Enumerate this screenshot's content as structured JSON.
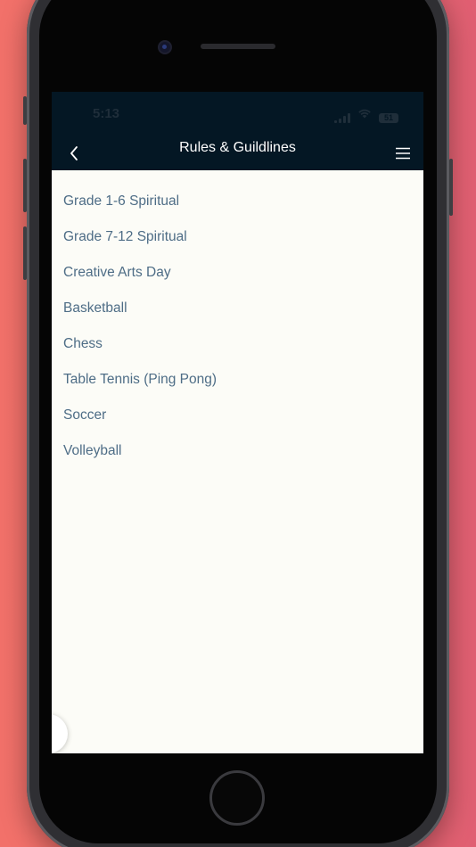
{
  "status_bar": {
    "time": "5:13",
    "battery": "51"
  },
  "nav": {
    "title": "Rules & Guildlines",
    "back_icon": "chevron-left-icon",
    "menu_icon": "hamburger-menu-icon"
  },
  "items": [
    {
      "label": "Grade 1-6 Spiritual"
    },
    {
      "label": "Grade 7-12 Spiritual"
    },
    {
      "label": "Creative Arts Day"
    },
    {
      "label": "Basketball"
    },
    {
      "label": "Chess"
    },
    {
      "label": "Table Tennis (Ping Pong)"
    },
    {
      "label": "Soccer"
    },
    {
      "label": "Volleyball"
    }
  ],
  "colors": {
    "nav_background": "#041724",
    "list_text": "#4e6d86",
    "screen_background": "#fcfcf7",
    "page_background": "#ef6d6c"
  }
}
